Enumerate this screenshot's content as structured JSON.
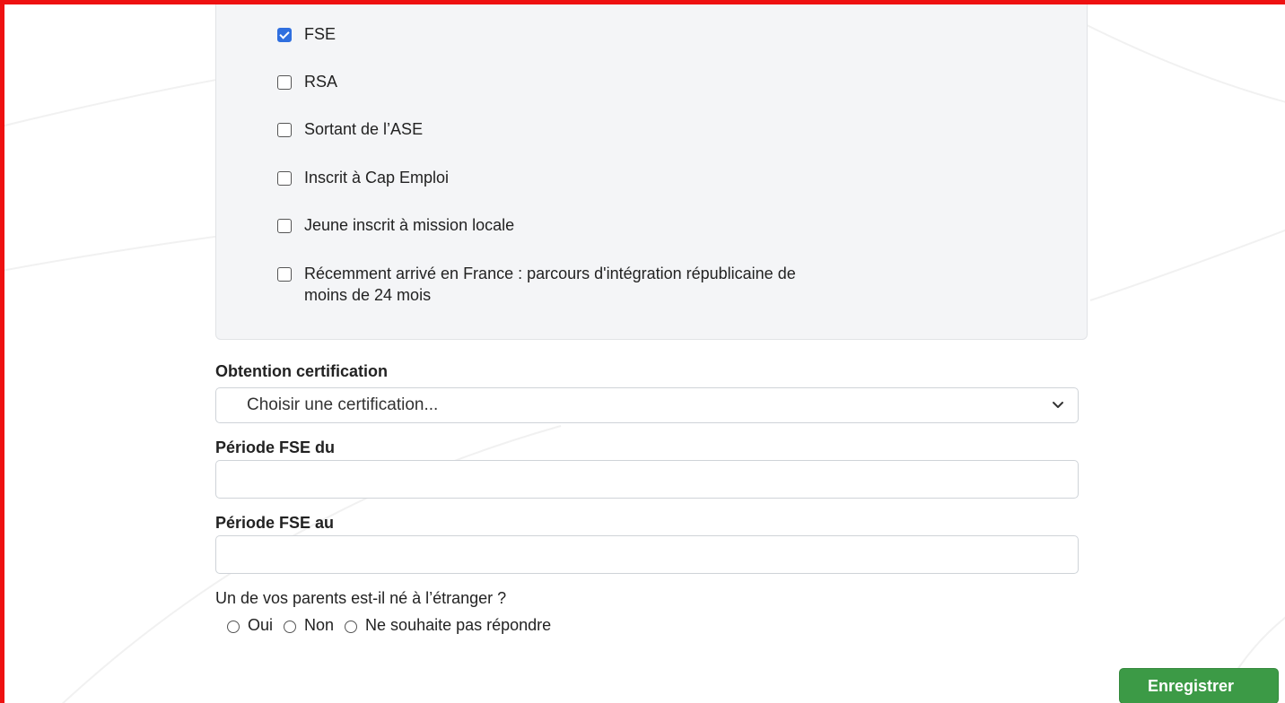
{
  "checkbox_panel": {
    "items": [
      {
        "label": "FSE",
        "checked": true
      },
      {
        "label": "RSA",
        "checked": false
      },
      {
        "label": "Sortant de l’ASE",
        "checked": false
      },
      {
        "label": "Inscrit à Cap Emploi",
        "checked": false
      },
      {
        "label": "Jeune inscrit à mission locale",
        "checked": false
      },
      {
        "label": "Récemment arrivé en France : parcours d'intégration républicaine de moins de 24 mois",
        "checked": false
      }
    ]
  },
  "certification": {
    "label": "Obtention certification",
    "placeholder": "Choisir une certification..."
  },
  "periode_du": {
    "label": "Période FSE du",
    "value": ""
  },
  "periode_au": {
    "label": "Période FSE au",
    "value": ""
  },
  "parent_question": {
    "label": "Un de vos parents est-il né à l’étranger ?",
    "options": [
      "Oui",
      "Non",
      "Ne souhaite pas répondre"
    ],
    "selected": null
  },
  "save_button": {
    "label": "Enregistrer"
  },
  "colors": {
    "frame_border": "#ee1111",
    "checkbox_checked": "#2f6fdf",
    "save_button": "#3c9a46",
    "panel_background": "#f4f5f7"
  },
  "icons": {
    "select_chevron": "chevron-down-icon",
    "checkbox_check": "check-icon"
  }
}
